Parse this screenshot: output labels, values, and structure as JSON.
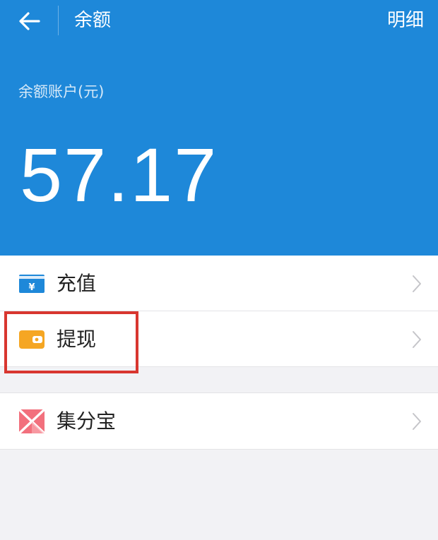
{
  "header": {
    "title": "余额",
    "detail_link": "明细",
    "account_label": "余额账户(元)",
    "balance": "57.17",
    "background_color": "#1e88d9"
  },
  "items": [
    {
      "label": "充值",
      "icon": "recharge-card-icon",
      "icon_glyph": "¥"
    },
    {
      "label": "提现",
      "icon": "withdraw-wallet-icon"
    },
    {
      "label": "集分宝",
      "icon": "jifenbao-icon"
    }
  ],
  "annotation": {
    "highlight_color": "#d8362f"
  }
}
